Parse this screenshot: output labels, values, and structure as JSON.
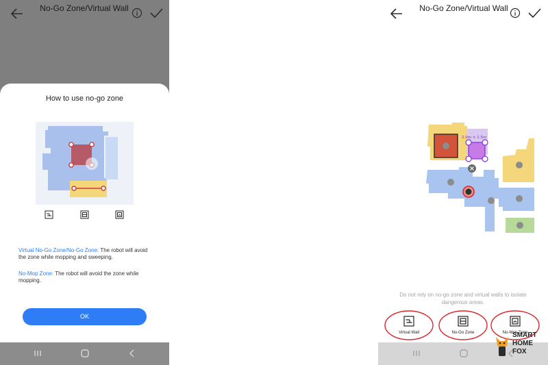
{
  "left_screen": {
    "header": {
      "title": "No-Go Zone/Virtual Wall"
    },
    "dialog": {
      "title": "How to use no-go zone",
      "desc1_highlight": "Virtual No-Go Zone/No-Go Zone:",
      "desc1_text": " The robot will avoid the zone while mopping and sweeping.",
      "desc2_highlight": "No-Mop Zone:",
      "desc2_text": " The robot will avoid the zone while mopping.",
      "ok_label": "OK"
    }
  },
  "right_screen": {
    "header": {
      "title": "No-Go Zone/Virtual Wall"
    },
    "map": {
      "zone_size_label": "2.0m × 1.5m"
    },
    "warning": "Do not rely on no-go zone and virtual walls to isolate dangerous areas.",
    "tools": [
      {
        "label": "Virtual Wall",
        "icon": "virtual-wall-icon"
      },
      {
        "label": "No-Go Zone",
        "icon": "no-go-zone-icon"
      },
      {
        "label": "No-Mop Zone",
        "icon": "no-mop-zone-icon"
      }
    ]
  },
  "watermark": {
    "line1": "SMART",
    "line2": "HOME",
    "line3": "FOX"
  },
  "colors": {
    "accent": "#2f7df6",
    "highlight_ring": "#d9262b",
    "room_blue": "#a9c4ef",
    "room_yellow": "#f4d77a",
    "room_green": "#b7d99a",
    "zone_red": "#d2553b",
    "zone_purple": "#c77be6"
  }
}
